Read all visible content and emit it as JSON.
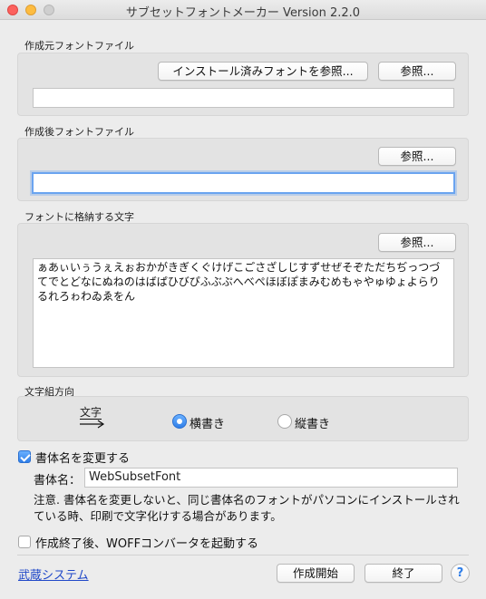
{
  "window": {
    "title": "サブセットフォントメーカー Version 2.2.0"
  },
  "source_font": {
    "label": "作成元フォントファイル",
    "installed_button": "インストール済みフォントを参照...",
    "browse_button": "参照...",
    "path_value": ""
  },
  "output_font": {
    "label": "作成後フォントファイル",
    "browse_button": "参照...",
    "path_value": ""
  },
  "chars": {
    "label": "フォントに格納する文字",
    "browse_button": "参照...",
    "content": "ぁあぃいぅうぇえぉおかがきぎくぐけげこごさざしじすずせぜそぞただちぢっつづてでとどなにぬねのはばぱひびぴふぶぷへべぺほぼぽまみむめもゃやゅゆょよらりるれろゎわゐゑをん"
  },
  "orientation": {
    "label": "文字組方向",
    "icon_text": "文字",
    "horizontal_label": "横書き",
    "vertical_label": "縦書き",
    "selected": "横書き"
  },
  "rename": {
    "checkbox_label": "書体名を変更する",
    "checked": true,
    "name_label": "書体名：",
    "name_value": "WebSubsetFont",
    "note": "注意. 書体名を変更しないと、同じ書体名のフォントがパソコンにインストールされている時、印刷で文字化けする場合があります。"
  },
  "woff": {
    "checkbox_label": "作成終了後、WOFFコンバータを起動する",
    "checked": false
  },
  "footer": {
    "link": "武蔵システム",
    "start_button": "作成開始",
    "quit_button": "終了",
    "help_button": "?"
  }
}
